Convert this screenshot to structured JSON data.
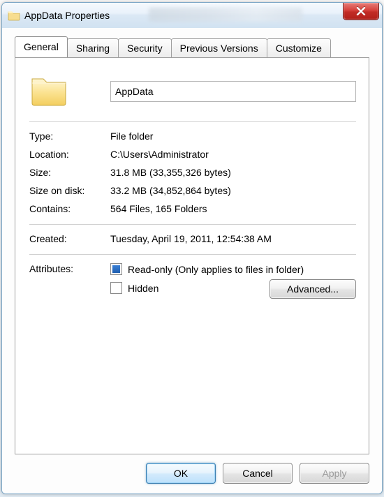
{
  "titlebar": {
    "title": "AppData Properties"
  },
  "tabs": {
    "general": "General",
    "sharing": "Sharing",
    "security": "Security",
    "previous": "Previous Versions",
    "customize": "Customize"
  },
  "general": {
    "name": "AppData",
    "type_label": "Type:",
    "type_value": "File folder",
    "location_label": "Location:",
    "location_value": "C:\\Users\\Administrator",
    "size_label": "Size:",
    "size_value": "31.8 MB (33,355,326 bytes)",
    "sod_label": "Size on disk:",
    "sod_value": "33.2 MB (34,852,864 bytes)",
    "contains_label": "Contains:",
    "contains_value": "564 Files, 165 Folders",
    "created_label": "Created:",
    "created_value": "Tuesday, April 19, 2011, 12:54:38 AM",
    "attributes_label": "Attributes:",
    "readonly_label": "Read-only (Only applies to files in folder)",
    "hidden_label": "Hidden",
    "advanced_label": "Advanced..."
  },
  "buttons": {
    "ok": "OK",
    "cancel": "Cancel",
    "apply": "Apply"
  }
}
